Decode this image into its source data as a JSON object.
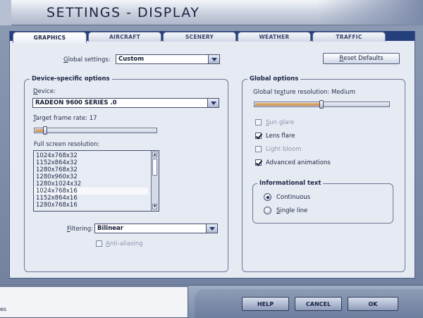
{
  "window": {
    "title": "SETTINGS - DISPLAY"
  },
  "tabs": [
    "GRAPHICS",
    "AIRCRAFT",
    "SCENERY",
    "WEATHER",
    "TRAFFIC"
  ],
  "global_settings": {
    "label_pre": "G",
    "label_rest": "lobal settings:",
    "value": "Custom",
    "reset_pre": "R",
    "reset_rest": "eset Defaults"
  },
  "device_group": {
    "title": "Device-specific options",
    "device_label_pre": "D",
    "device_label_rest": "evice:",
    "device_value": "RADEON 9600 SERIES    .0",
    "frame_rate_pre": "T",
    "frame_rate_rest": "arget frame rate: 17",
    "frame_rate_level": 0.09,
    "resolution_label": "Full screen resolution:",
    "resolutions": [
      "1024x768x32",
      "1152x864x32",
      "1280x768x32",
      "1280x960x32",
      "1280x1024x32",
      "1024x768x16",
      "1152x864x16",
      "1280x768x16"
    ],
    "selected_resolution_index": 5,
    "filtering_pre": "F",
    "filtering_rest": "iltering:",
    "filtering_value": "Bilinear",
    "anti_aliasing_pre": "A",
    "anti_aliasing_rest": "nti-aliasing",
    "anti_aliasing_checked": false
  },
  "global_group": {
    "title": "Global options",
    "texture_label_a": "Global te",
    "texture_label_u": "x",
    "texture_label_b": "ture resolution: Medium",
    "texture_level": 0.5,
    "options": [
      {
        "pre": "S",
        "rest": "un glare",
        "checked": false,
        "enabled": false
      },
      {
        "pre": "",
        "rest": "Lens flare",
        "checked": true,
        "enabled": true
      },
      {
        "pre": "",
        "rest": "Light bloom",
        "checked": false,
        "enabled": false
      },
      {
        "pre": "",
        "rest": "Advanced animations",
        "checked": true,
        "enabled": true
      }
    ],
    "info": {
      "title": "Informational text",
      "continuous": "Continuous",
      "single_pre": "S",
      "single_rest": "ingle line",
      "selected": "continuous"
    }
  },
  "footer": {
    "status_text": "es",
    "help": "HELP",
    "cancel": "CANCEL",
    "ok": "OK"
  },
  "colors": {
    "accent_navy": "#253f7c",
    "panel": "#e6eaf3",
    "slider_fill": "#d9a062"
  }
}
